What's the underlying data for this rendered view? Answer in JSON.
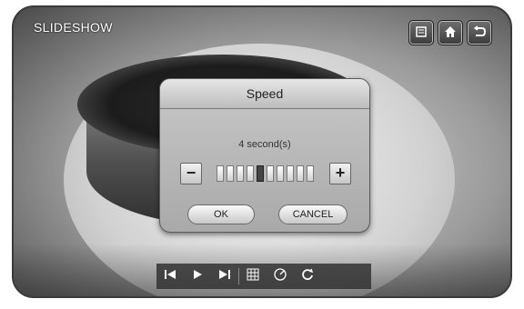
{
  "header": {
    "title": "SLIDESHOW"
  },
  "topbar": {
    "icons": [
      "settings-icon",
      "home-icon",
      "return-icon"
    ]
  },
  "dialog": {
    "title": "Speed",
    "value": "4 second(s)",
    "minus_label": "−",
    "plus_label": "+",
    "level_fraction": 0.4,
    "ok_label": "OK",
    "cancel_label": "CANCEL"
  },
  "controls": {
    "icons": [
      "previous-icon",
      "play-icon",
      "next-icon",
      "grid-icon",
      "speed-icon",
      "repeat-icon"
    ]
  },
  "colors": {
    "frame": "#3a3a3a",
    "dialog": "#bdbdbd",
    "text": "#222222"
  }
}
